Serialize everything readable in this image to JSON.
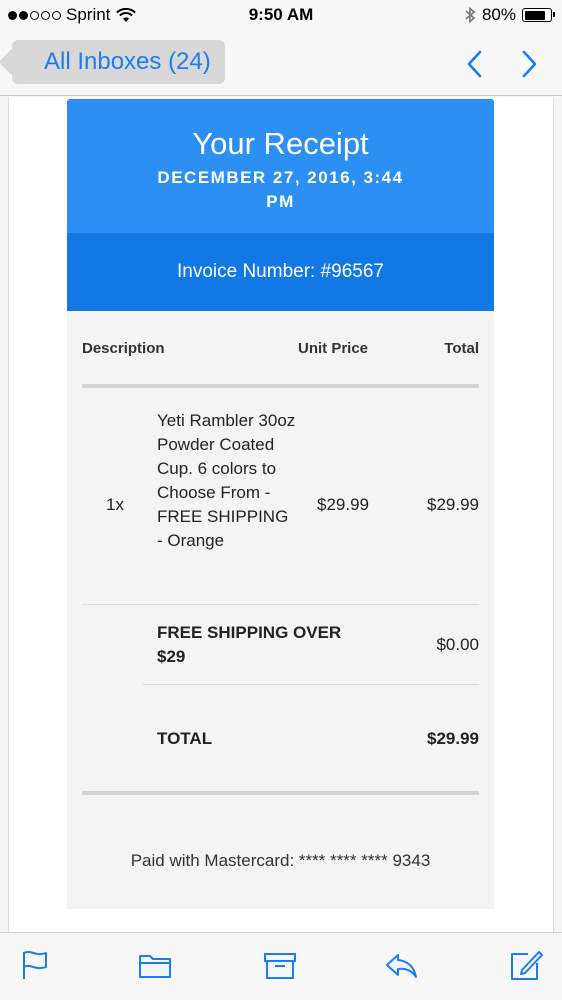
{
  "status_bar": {
    "carrier": "Sprint",
    "time": "9:50 AM",
    "battery": "80%",
    "battery_level": 0.8,
    "signal_bars_filled": 2,
    "signal_bars_total": 5
  },
  "nav": {
    "back_label": "All Inboxes (24)",
    "prev_icon": "chevron-up-icon",
    "next_icon": "chevron-down-icon"
  },
  "receipt": {
    "title": "Your Receipt",
    "date": "DECEMBER 27, 2016, 3:44 PM",
    "invoice": "Invoice Number: #96567",
    "columns": [
      "Description",
      "Unit Price",
      "Total"
    ],
    "items": [
      {
        "qty": "1x",
        "description": "Yeti Rambler 30oz Powder Coated Cup. 6 colors to Choose From - FREE SHIPPING - Orange",
        "unit_price": "$29.99",
        "total": "$29.99"
      }
    ],
    "shipping": {
      "label": "FREE SHIPPING OVER $29",
      "amount": "$0.00"
    },
    "total": {
      "label": "TOTAL",
      "amount": "$29.99"
    },
    "payment": "Paid with Mastercard: **** **** **** 9343"
  },
  "toolbar": {
    "icons": [
      "flag-icon",
      "folder-icon",
      "archive-icon",
      "reply-icon",
      "compose-icon"
    ]
  },
  "colors": {
    "accent": "#1a7ef0",
    "receipt_header": "#2c8ff3",
    "invoice_band": "#1178e6"
  }
}
